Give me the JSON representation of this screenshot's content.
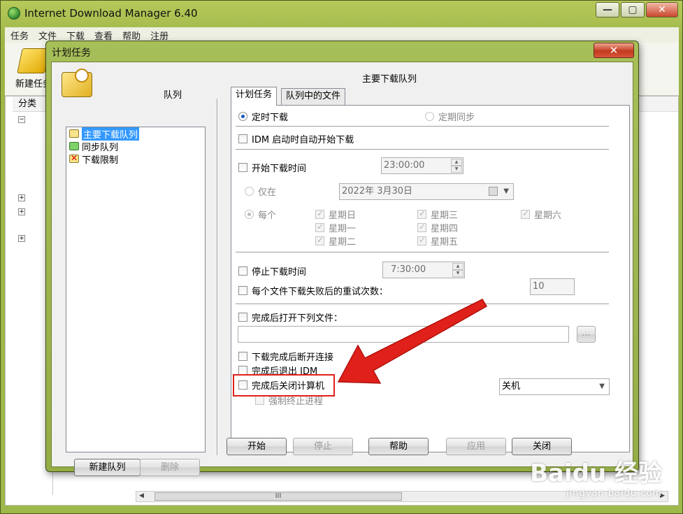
{
  "app": {
    "title": "Internet Download Manager 6.40",
    "menu": [
      "任务",
      "文件",
      "下载",
      "查看",
      "帮助",
      "注册"
    ],
    "toolbar_new": "新建任务",
    "category_header": "分类"
  },
  "dialog": {
    "title": "计划任务",
    "queue_label": "队列",
    "queues": [
      {
        "label": "主要下载队列",
        "selected": true
      },
      {
        "label": "同步队列",
        "selected": false
      },
      {
        "label": "下载限制",
        "selected": false
      }
    ],
    "new_queue_button": "新建队列",
    "delete_button": "删除",
    "queue_title": "主要下载队列",
    "tabs": [
      "计划任务",
      "队列中的文件"
    ],
    "mode_once": "定时下载",
    "mode_sync": "定期同步",
    "auto_start_idm": "IDM 启动时自动开始下载",
    "start_time_label": "开始下载时间",
    "start_time_value": "23:00:00",
    "only_on_label": "仅在",
    "only_on_date": "2022年  3月30日",
    "every_label": "每个",
    "days": {
      "sun": "星期日",
      "mon": "星期一",
      "tue": "星期二",
      "wed": "星期三",
      "thu": "星期四",
      "fri": "星期五",
      "sat": "星期六"
    },
    "stop_time_label": "停止下载时间",
    "stop_time_value": "7:30:00",
    "retry_label": "每个文件下载失败后的重试次数：",
    "retry_value": "10",
    "open_file_label": "完成后打开下列文件：",
    "browse_button": "...",
    "hangup_label": "下载完成后断开连接",
    "exit_idm_label": "完成后退出 IDM",
    "shutdown_label": "完成后关闭计算机",
    "shutdown_mode": "关机",
    "force_kill_label": "强制终止进程",
    "buttons": {
      "start": "开始",
      "stop": "停止",
      "help": "帮助",
      "apply": "应用",
      "close": "关闭"
    }
  },
  "watermark": {
    "brand": "Baidu 经验",
    "url": "jingyan.baidu.com"
  },
  "colors": {
    "frame_green": "#9fb84a",
    "selection_blue": "#3399ff",
    "annotation_red": "#e0201a"
  }
}
